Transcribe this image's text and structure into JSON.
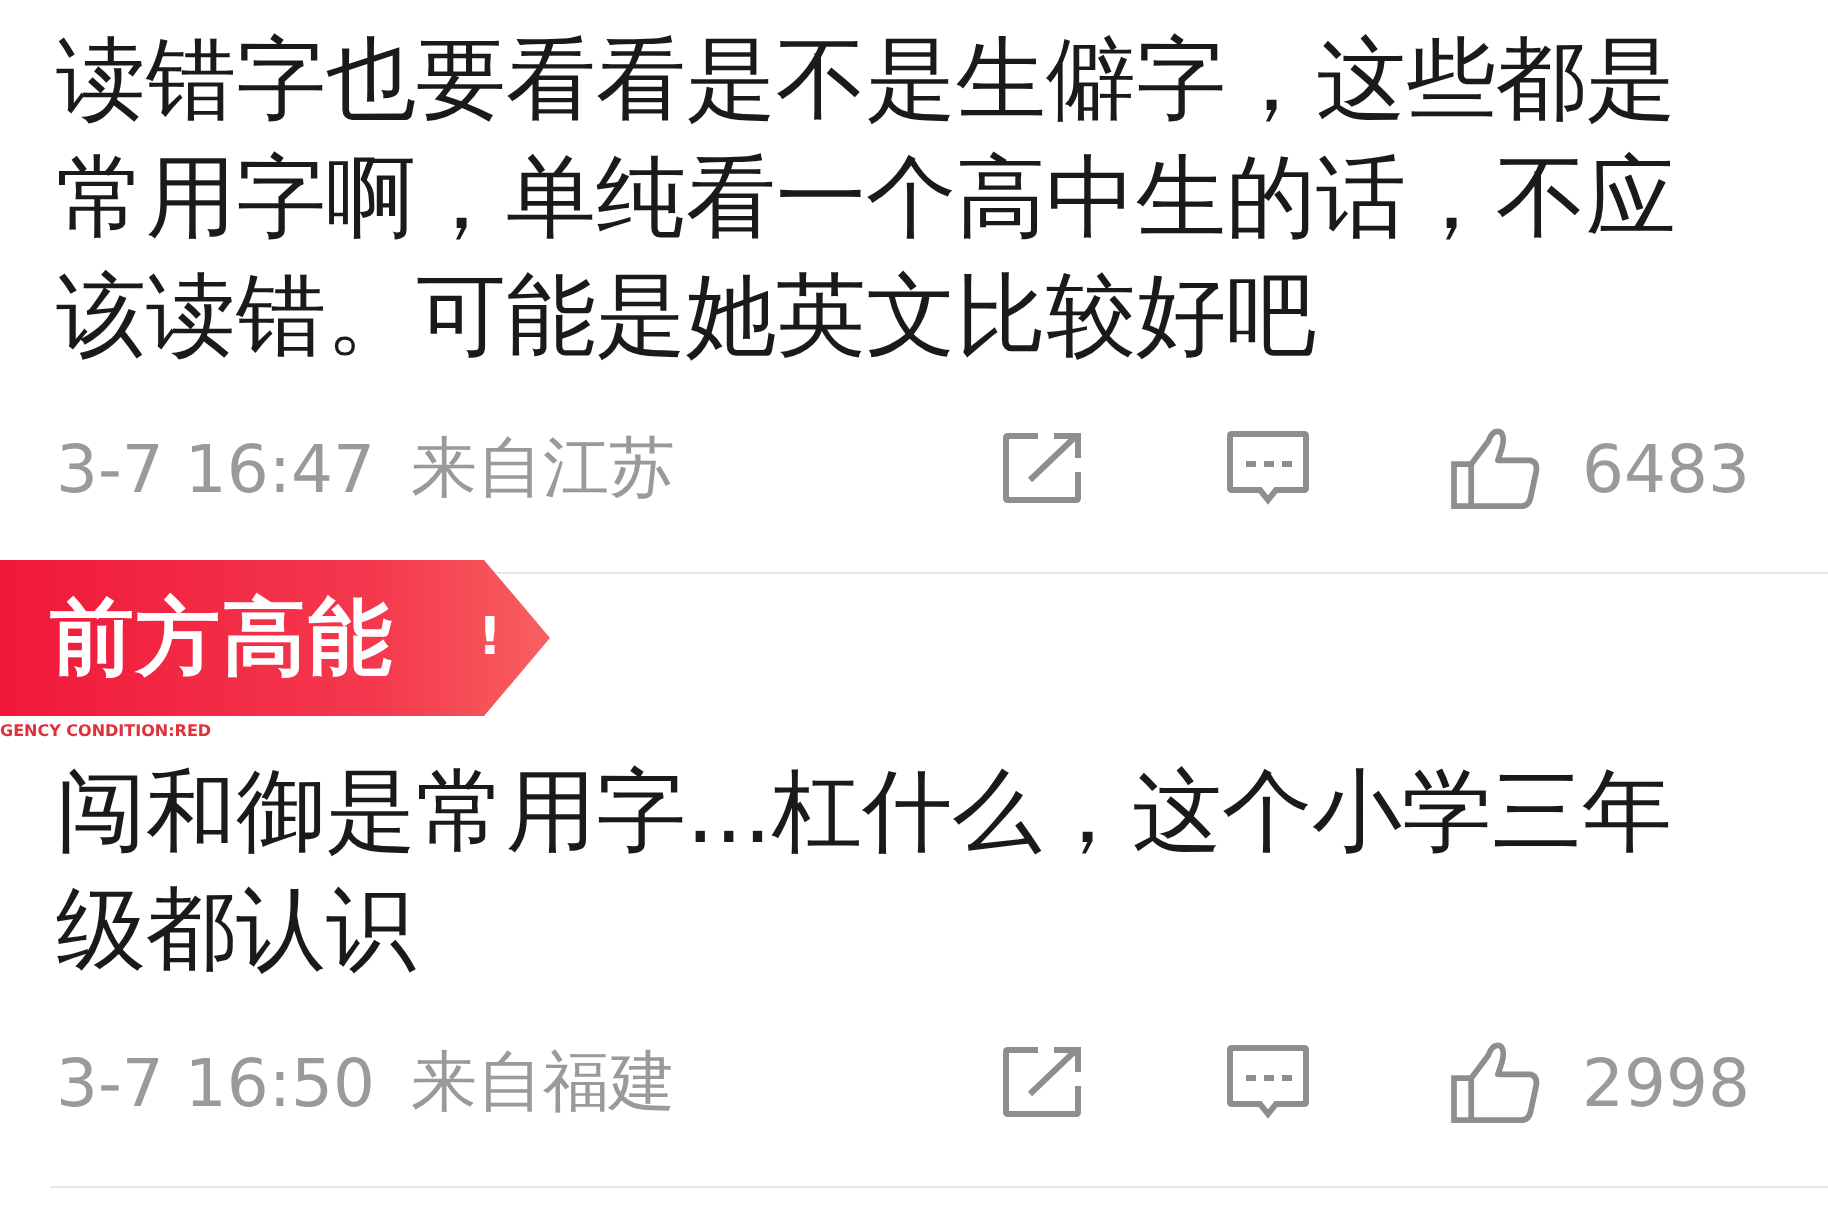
{
  "comments": [
    {
      "text": "读错字也要看看是不是生僻字，这些都是常用字啊，单纯看一个高中生的话，不应该读错。可能是她英文比较好吧",
      "time": "3-7 16:47",
      "location": "来自江苏",
      "likes": "6483"
    },
    {
      "badge": {
        "title": "前方高能",
        "mark": "!",
        "caption": "GENCY CONDITION:RED"
      },
      "text": "闯和御是常用字...杠什么，这个小学三年级都认识",
      "time": "3-7 16:50",
      "location": "来自福建",
      "likes": "2998"
    }
  ]
}
